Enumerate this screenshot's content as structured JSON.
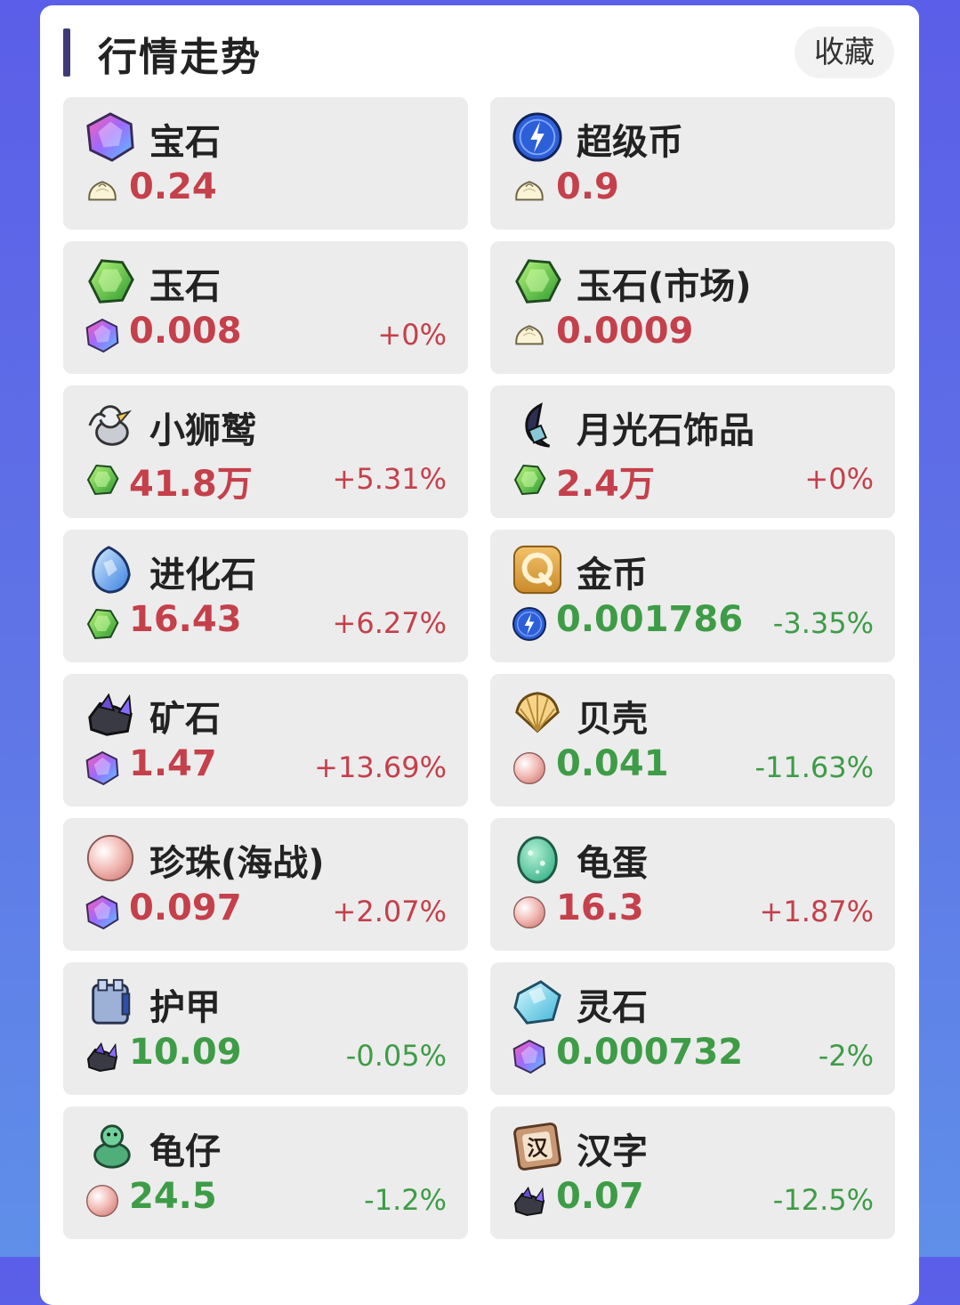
{
  "header": {
    "title": "行情走势",
    "fav_label": "收藏"
  },
  "items": [
    {
      "name": "宝石",
      "icon": "gem-icon",
      "currency_icon": "bun-icon",
      "price": "0.24",
      "change": "",
      "trend": "up"
    },
    {
      "name": "超级币",
      "icon": "super-coin-icon",
      "currency_icon": "bun-icon",
      "price": "0.9",
      "change": "",
      "trend": "up"
    },
    {
      "name": "玉石",
      "icon": "jade-icon",
      "currency_icon": "gem-icon",
      "price": "0.008",
      "change": "+0%",
      "trend": "up"
    },
    {
      "name": "玉石(市场)",
      "icon": "jade-icon",
      "currency_icon": "bun-icon",
      "price": "0.0009",
      "change": "",
      "trend": "up"
    },
    {
      "name": "小狮鹫",
      "icon": "griffin-icon",
      "currency_icon": "jade-icon",
      "price": "41.8万",
      "change": "+5.31%",
      "trend": "up"
    },
    {
      "name": "月光石饰品",
      "icon": "moonstone-icon",
      "currency_icon": "jade-icon",
      "price": "2.4万",
      "change": "+0%",
      "trend": "up"
    },
    {
      "name": "进化石",
      "icon": "evolution-stone-icon",
      "currency_icon": "jade-icon",
      "price": "16.43",
      "change": "+6.27%",
      "trend": "up"
    },
    {
      "name": "金币",
      "icon": "gold-coin-icon",
      "currency_icon": "super-coin-icon",
      "price": "0.001786",
      "change": "-3.35%",
      "trend": "down"
    },
    {
      "name": "矿石",
      "icon": "ore-icon",
      "currency_icon": "gem-icon",
      "price": "1.47",
      "change": "+13.69%",
      "trend": "up"
    },
    {
      "name": "贝壳",
      "icon": "shell-icon",
      "currency_icon": "pearl-icon",
      "price": "0.041",
      "change": "-11.63%",
      "trend": "down"
    },
    {
      "name": "珍珠(海战)",
      "icon": "pearl-icon",
      "currency_icon": "gem-icon",
      "price": "0.097",
      "change": "+2.07%",
      "trend": "up"
    },
    {
      "name": "龟蛋",
      "icon": "turtle-egg-icon",
      "currency_icon": "pearl-icon",
      "price": "16.3",
      "change": "+1.87%",
      "trend": "up"
    },
    {
      "name": "护甲",
      "icon": "armor-icon",
      "currency_icon": "ore-icon",
      "price": "10.09",
      "change": "-0.05%",
      "trend": "down"
    },
    {
      "name": "灵石",
      "icon": "spirit-stone-icon",
      "currency_icon": "gem-icon",
      "price": "0.000732",
      "change": "-2%",
      "trend": "down"
    },
    {
      "name": "龟仔",
      "icon": "turtle-icon",
      "currency_icon": "pearl-icon",
      "price": "24.5",
      "change": "-1.2%",
      "trend": "down"
    },
    {
      "name": "汉字",
      "icon": "hanzi-icon",
      "currency_icon": "ore-icon",
      "price": "0.07",
      "change": "-12.5%",
      "trend": "down"
    }
  ],
  "colors": {
    "up": "#c4404b",
    "down": "#3e9c47",
    "accent": "#3e3a78"
  }
}
